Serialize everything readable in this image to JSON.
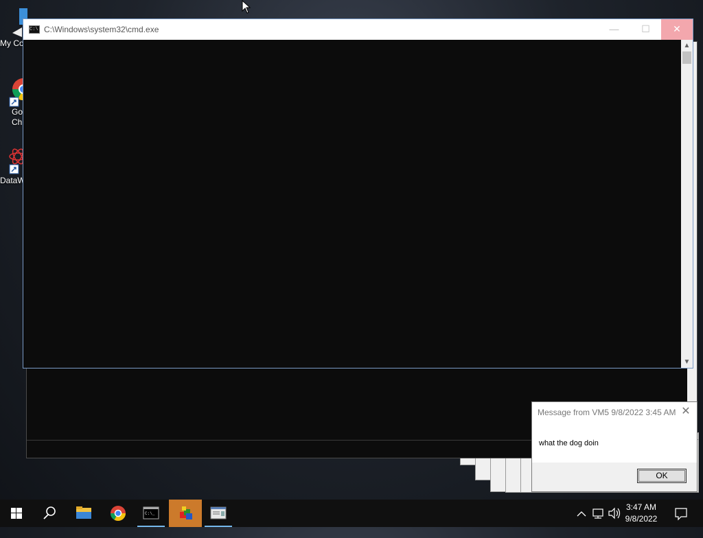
{
  "desktop": {
    "icons": [
      {
        "label": "My Co",
        "icon": "computer-icon"
      },
      {
        "label": "Go\nCh",
        "icon": "chrome-icon"
      },
      {
        "label": "DataW",
        "icon": "datawrangler-icon"
      }
    ]
  },
  "cmd_window": {
    "title": "C:\\Windows\\system32\\cmd.exe",
    "minimize": "—",
    "maximize": "☐",
    "close": "✕"
  },
  "message_dialog": {
    "title": "Message from VM5 9/8/2022 3:45 AM",
    "body": "what the dog doin",
    "ok_label": "OK"
  },
  "taskbar": {
    "items": [
      "start-icon",
      "search-icon",
      "file-explorer-icon",
      "chrome-icon",
      "cmd-icon",
      "app-cube-icon",
      "message-app-icon"
    ],
    "clock_time": "3:47 AM",
    "clock_date": "9/8/2022"
  },
  "colors": {
    "taskbar_bg": "#101010",
    "active_task": "#cc7a2b",
    "close_hover": "#f3a7ad",
    "console_bg": "#0c0c0c"
  }
}
